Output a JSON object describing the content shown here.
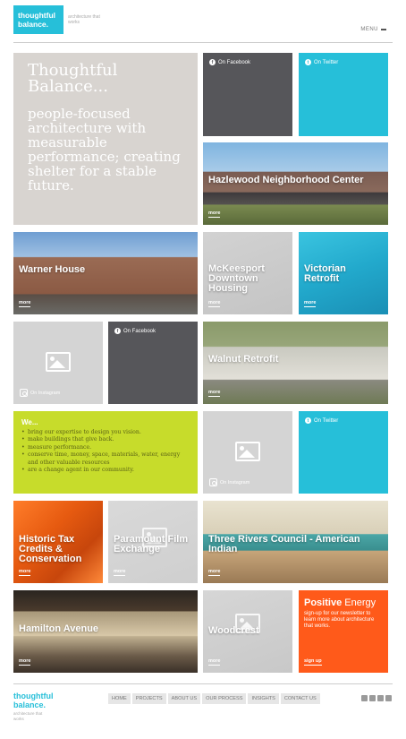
{
  "header": {
    "logo_text_1": "thoughtful",
    "logo_text_2": "balance.",
    "tagline": "architecture that works",
    "menu_label": "MENU"
  },
  "hero": {
    "title": "Thoughtful Balance...",
    "body": "people-focused architecture with measurable performance; creating shelter for a stable future."
  },
  "social": {
    "facebook": "On Facebook",
    "twitter": "On Twitter",
    "instagram": "On Instagram"
  },
  "more_label": "more",
  "projects": {
    "hazelwood": "Hazlewood Neighborhood Center",
    "warner": "Warner House",
    "mckeesport": "McKeesport Downtown Housing",
    "victorian": "Victorian Retrofit",
    "walnut": "Walnut Retrofit",
    "historic": "Historic Tax Credits & Conservation",
    "paramount": "Paramount Film Exchange",
    "three_rivers": "Three Rivers Council - American Indian",
    "hamilton": "Hamilton Avenue",
    "woodcrest": "Woodcrest"
  },
  "we": {
    "title": "We...",
    "items": [
      "bring our expertise to design you vision.",
      "make buildings that give back.",
      "measure performance.",
      "conserve time, money, space, materials, water, energy and other valuable resources",
      "are a change agent in our community."
    ]
  },
  "positive": {
    "title_bold": "Positive",
    "title_normal": " Energy",
    "body": "sign-up for our newsletter to learn more about architecture that works.",
    "signup": "sign up"
  },
  "footer": {
    "logo_text_1": "thoughtful",
    "logo_text_2": "balance.",
    "tagline": "architecture that works",
    "nav": [
      "HOME",
      "PROJECTS",
      "ABOUT US",
      "OUR PROCESS",
      "INSIGHTS",
      "CONTACT US"
    ],
    "social_icons": [
      "facebook-icon",
      "twitter-icon",
      "linkedin-icon",
      "instagram-icon"
    ]
  },
  "colors": {
    "brand_cyan": "#26bfd9",
    "dark_gray": "#56565a",
    "lime": "#c7dc2b",
    "orange": "#ff5a1a"
  }
}
